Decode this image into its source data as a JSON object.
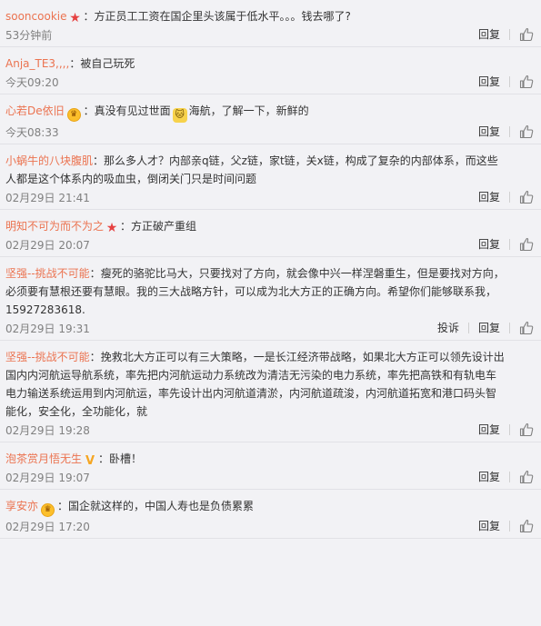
{
  "comments": [
    {
      "user": "sooncookie",
      "badge": "star",
      "text": "方正员工工资在国企里头该属于低水平。。。钱去哪了?",
      "time": "53分钟前"
    },
    {
      "user": "Anja_TE3,,,,",
      "badge": "",
      "text": "被自己玩死",
      "time": "今天09:20"
    },
    {
      "user": "心若De依旧",
      "badge": "crown",
      "text_before": "真没有见过世面",
      "emoji": "cat-emoji",
      "text_after": "海航，了解一下，新鲜的",
      "time": "今天08:33"
    },
    {
      "user": "小蜗牛的八块腹肌",
      "badge": "",
      "text": "那么多人才？内部亲q链，父z链，家t链，关x链，构成了复杂的内部体系，而这些人都是这个体系内的吸血虫，倒闭关门只是时间问题",
      "time": "02月29日 21:41"
    },
    {
      "user": "明知不可为而不为之",
      "badge": "star",
      "text": "方正破产重组",
      "time": "02月29日 20:07"
    },
    {
      "user": "坚强--挑战不可能",
      "badge": "",
      "text": "瘦死的骆驼比马大，只要找对了方向，就会像中兴一样涅磐重生，但是要找对方向，必须要有慧根还要有慧眼。我的三大战略方针，可以成为北大方正的正确方向。希望你们能够联系我，15927283618.",
      "time": "02月29日 19:31",
      "report": "投诉"
    },
    {
      "user": "坚强--挑战不可能",
      "badge": "",
      "text": "挽救北大方正可以有三大策略，一是长江经济带战略，如果北大方正可以领先设计出国内内河航运导航系统，率先把内河航运动力系统改为清洁无污染的电力系统，率先把高铁和有轨电车电力输送系统运用到内河航运，率先设计出内河航道清淤，内河航道疏浚，内河航道拓宽和港口码头智能化，安全化，全功能化，就",
      "time": "02月29日 19:28"
    },
    {
      "user": "泡茶赏月悟无生",
      "badge": "v",
      "text": "卧槽！",
      "time": "02月29日 19:07"
    },
    {
      "user": "享安亦",
      "badge": "crown",
      "text": "国企就这样的，中国人寿也是负债累累",
      "time": "02月29日 17:20"
    }
  ],
  "reply_label": "回复",
  "colors": {
    "username": "#eb7350",
    "background": "#f2f2f5",
    "time": "#808080"
  },
  "icons": {
    "like": "thumbs-up-icon",
    "star": "star-badge-icon",
    "crown": "crown-badge-icon",
    "v": "v-badge-icon"
  }
}
